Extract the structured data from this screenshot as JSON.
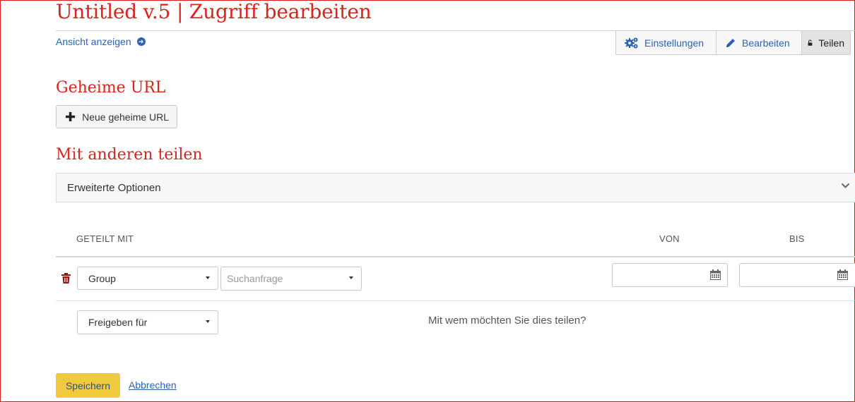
{
  "page": {
    "title": "Untitled v.5 | Zugriff bearbeiten",
    "view_link": "Ansicht anzeigen"
  },
  "tabs": [
    {
      "label": "Einstellungen",
      "icon": "cogs-icon"
    },
    {
      "label": "Bearbeiten",
      "icon": "pencil-icon"
    },
    {
      "label": "Teilen",
      "icon": "unlock-icon",
      "active": true
    }
  ],
  "secret_url": {
    "heading": "Geheime URL",
    "new_button": "Neue geheime URL"
  },
  "share": {
    "heading": "Mit anderen teilen",
    "advanced_options": "Erweiterte Optionen",
    "columns": {
      "shared_with": "GETEILT MIT",
      "from": "VON",
      "until": "BIS"
    },
    "rows": [
      {
        "type_value": "Group",
        "search_placeholder": "Suchanfrage",
        "from": "",
        "until": ""
      }
    ],
    "share_for_value": "Freigeben für",
    "question": "Mit wem möchten Sie dies teilen?"
  },
  "actions": {
    "save": "Speichern",
    "cancel": "Abbrechen"
  },
  "colors": {
    "heading_red": "#d9231d",
    "link_blue": "#2c62b5",
    "save_yellow": "#f1c93f",
    "trash_red": "#8b1a1a"
  }
}
